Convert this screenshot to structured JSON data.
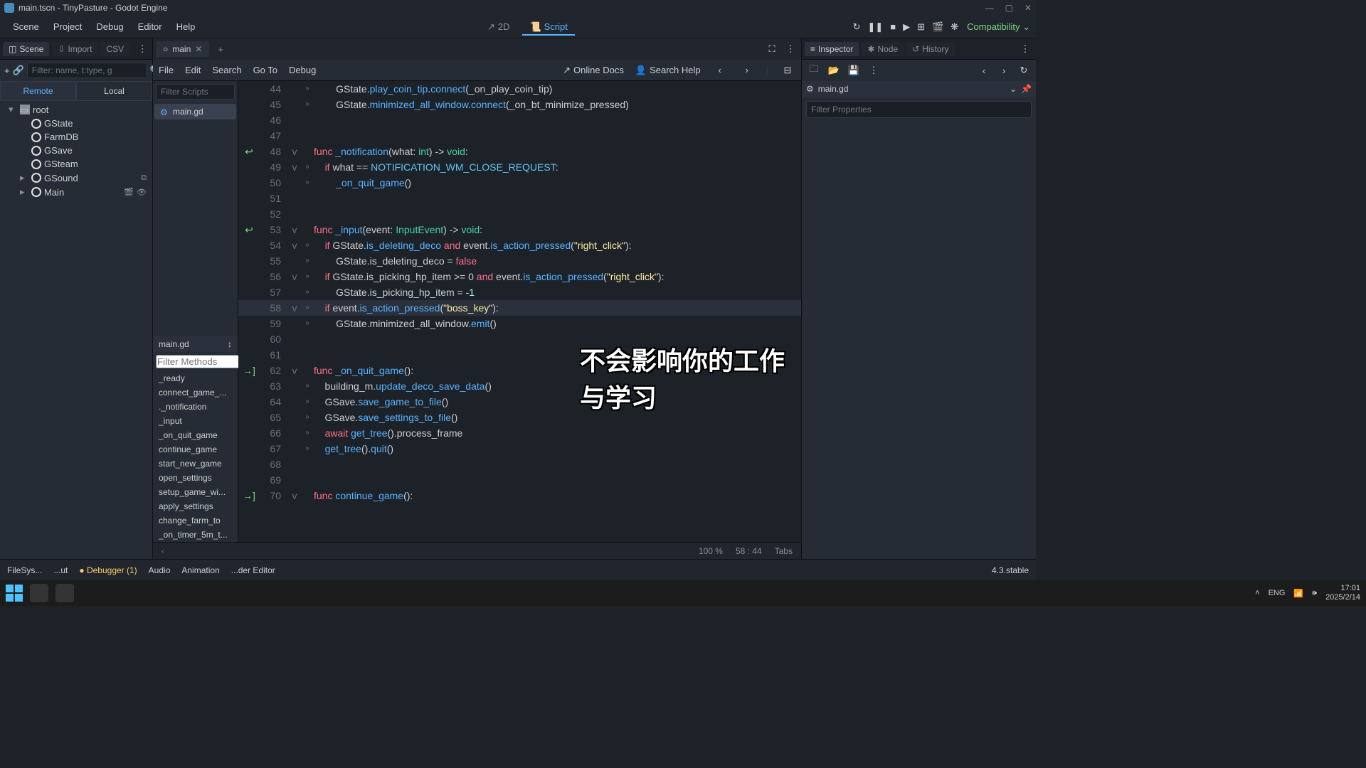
{
  "titlebar": {
    "title": "main.tscn - TinyPasture - Godot Engine"
  },
  "menubar": {
    "scene": "Scene",
    "project": "Project",
    "debug": "Debug",
    "editor": "Editor",
    "help": "Help",
    "view_2d": "2D",
    "view_script": "Script",
    "compat": "Compatibility"
  },
  "left": {
    "tab_scene": "Scene",
    "tab_import": "Import",
    "tab_csv": "CSV",
    "filter_placeholder": "Filter: name, t:type, g",
    "switch_remote": "Remote",
    "switch_local": "Local",
    "tree": [
      {
        "name": "root",
        "icon": "root",
        "indent": 0,
        "expand": "▾"
      },
      {
        "name": "GState",
        "icon": "node",
        "indent": 1
      },
      {
        "name": "FarmDB",
        "icon": "node",
        "indent": 1
      },
      {
        "name": "GSave",
        "icon": "node",
        "indent": 1
      },
      {
        "name": "GSteam",
        "icon": "node",
        "indent": 1
      },
      {
        "name": "GSound",
        "icon": "node",
        "indent": 1,
        "expand": "▸",
        "extras": [
          "⧉"
        ]
      },
      {
        "name": "Main",
        "icon": "node",
        "indent": 1,
        "expand": "▸",
        "extras": [
          "🎬",
          "👁"
        ]
      }
    ]
  },
  "tabs": {
    "main_tab": "main"
  },
  "script_bar": {
    "file": "File",
    "edit": "Edit",
    "search": "Search",
    "goto": "Go To",
    "debug": "Debug",
    "online_docs": "Online Docs",
    "search_help": "Search Help"
  },
  "scripts": {
    "filter_placeholder": "Filter Scripts",
    "items": [
      "main.gd"
    ],
    "current": "main.gd",
    "methods_filter": "Filter Methods",
    "methods": [
      "_ready",
      "connect_game_...",
      "._notification",
      "_input",
      "_on_quit_game",
      "continue_game",
      "start_new_game",
      "open_settings",
      "setup_game_wi...",
      "apply_settings",
      "change_farm_to",
      "_on_timer_5m_t..."
    ]
  },
  "code": {
    "lines": [
      {
        "n": 44,
        "bm": "»",
        "html": "        GState.<span class='method'>play_coin_tip</span>.<span class='method'>connect</span>(_on_play_coin_tip)"
      },
      {
        "n": 45,
        "bm": "»",
        "html": "        GState.<span class='method'>minimized_all_window</span>.<span class='method'>connect</span>(_on_bt_minimize_pressed)"
      },
      {
        "n": 46,
        "html": ""
      },
      {
        "n": 47,
        "html": ""
      },
      {
        "n": 48,
        "ext": "↩",
        "fold": "v",
        "html": "<span class='kw'>func</span> <span class='fn'>_notification</span>(what: <span class='type'>int</span>) -> <span class='type'>void</span>:"
      },
      {
        "n": 49,
        "fold": "v",
        "bm": "»",
        "html": "    <span class='kw'>if</span> what == <span class='const'>NOTIFICATION_WM_CLOSE_REQUEST</span>:"
      },
      {
        "n": 50,
        "bm": "»",
        "html": "        <span class='method'>_on_quit_game</span>()"
      },
      {
        "n": 51,
        "html": ""
      },
      {
        "n": 52,
        "html": ""
      },
      {
        "n": 53,
        "ext": "↩",
        "fold": "v",
        "html": "<span class='kw'>func</span> <span class='fn'>_input</span>(event: <span class='type'>InputEvent</span>) -> <span class='type'>void</span>:"
      },
      {
        "n": 54,
        "fold": "v",
        "bm": "»",
        "html": "    <span class='kw'>if</span> GState.<span class='method'>is_deleting_deco</span> <span class='kw'>and</span> event.<span class='method'>is_action_pressed</span>(<span class='str'>\"right_click\"</span>):"
      },
      {
        "n": 55,
        "bm": "»",
        "html": "        GState.is_deleting_deco = <span class='bool'>false</span>"
      },
      {
        "n": 56,
        "fold": "v",
        "bm": "»",
        "html": "    <span class='kw'>if</span> GState.is_picking_hp_item >= 0 <span class='kw'>and</span> event.<span class='method'>is_action_pressed</span>(<span class='str'>\"right_click\"</span>):"
      },
      {
        "n": 57,
        "bm": "»",
        "html": "        GState.is_picking_hp_item = <span class='num'>-1</span>"
      },
      {
        "n": 58,
        "fold": "v",
        "bm": "»",
        "cur": true,
        "html": "    <span class='kw'>if</span> event.<span class='method'>is_action_pressed</span>(<span class='str'>\"boss_key\"</span>):"
      },
      {
        "n": 59,
        "bm": "»",
        "html": "        GState.minimized_all_window.<span class='method'>emit</span>()"
      },
      {
        "n": 60,
        "html": ""
      },
      {
        "n": 61,
        "html": ""
      },
      {
        "n": 62,
        "ext": "→]",
        "fold": "v",
        "html": "<span class='kw'>func</span> <span class='fn'>_on_quit_game</span>():"
      },
      {
        "n": 63,
        "bm": "»",
        "html": "    building_m.<span class='method'>update_deco_save_data</span>()"
      },
      {
        "n": 64,
        "bm": "»",
        "html": "    GSave.<span class='method'>save_game_to_file</span>()"
      },
      {
        "n": 65,
        "bm": "»",
        "html": "    GSave.<span class='method'>save_settings_to_file</span>()"
      },
      {
        "n": 66,
        "bm": "»",
        "html": "    <span class='kw'>await</span> <span class='method'>get_tree</span>().process_frame"
      },
      {
        "n": 67,
        "bm": "»",
        "html": "    <span class='method'>get_tree</span>().<span class='method'>quit</span>()"
      },
      {
        "n": 68,
        "html": ""
      },
      {
        "n": 69,
        "html": ""
      },
      {
        "n": 70,
        "ext": "→]",
        "fold": "v",
        "html": "<span class='kw'>func</span> <span class='fn'>continue_game</span>():"
      }
    ]
  },
  "overlay_text": "不会影响你的工作与学习",
  "status": {
    "zoom": "100 %",
    "pos": "58 : 44",
    "tabs": "Tabs"
  },
  "inspector": {
    "tab_inspector": "Inspector",
    "tab_node": "Node",
    "tab_history": "History",
    "resource": "main.gd",
    "filter_placeholder": "Filter Properties"
  },
  "bottom": {
    "filesystem": "FileSys...",
    "output": "...ut",
    "debugger": "Debugger (1)",
    "audio": "Audio",
    "animation": "Animation",
    "shader": "...der Editor",
    "version": "4.3.stable"
  },
  "taskbar": {
    "lang": "ENG",
    "time": "17:01",
    "date": "2025/2/14"
  }
}
